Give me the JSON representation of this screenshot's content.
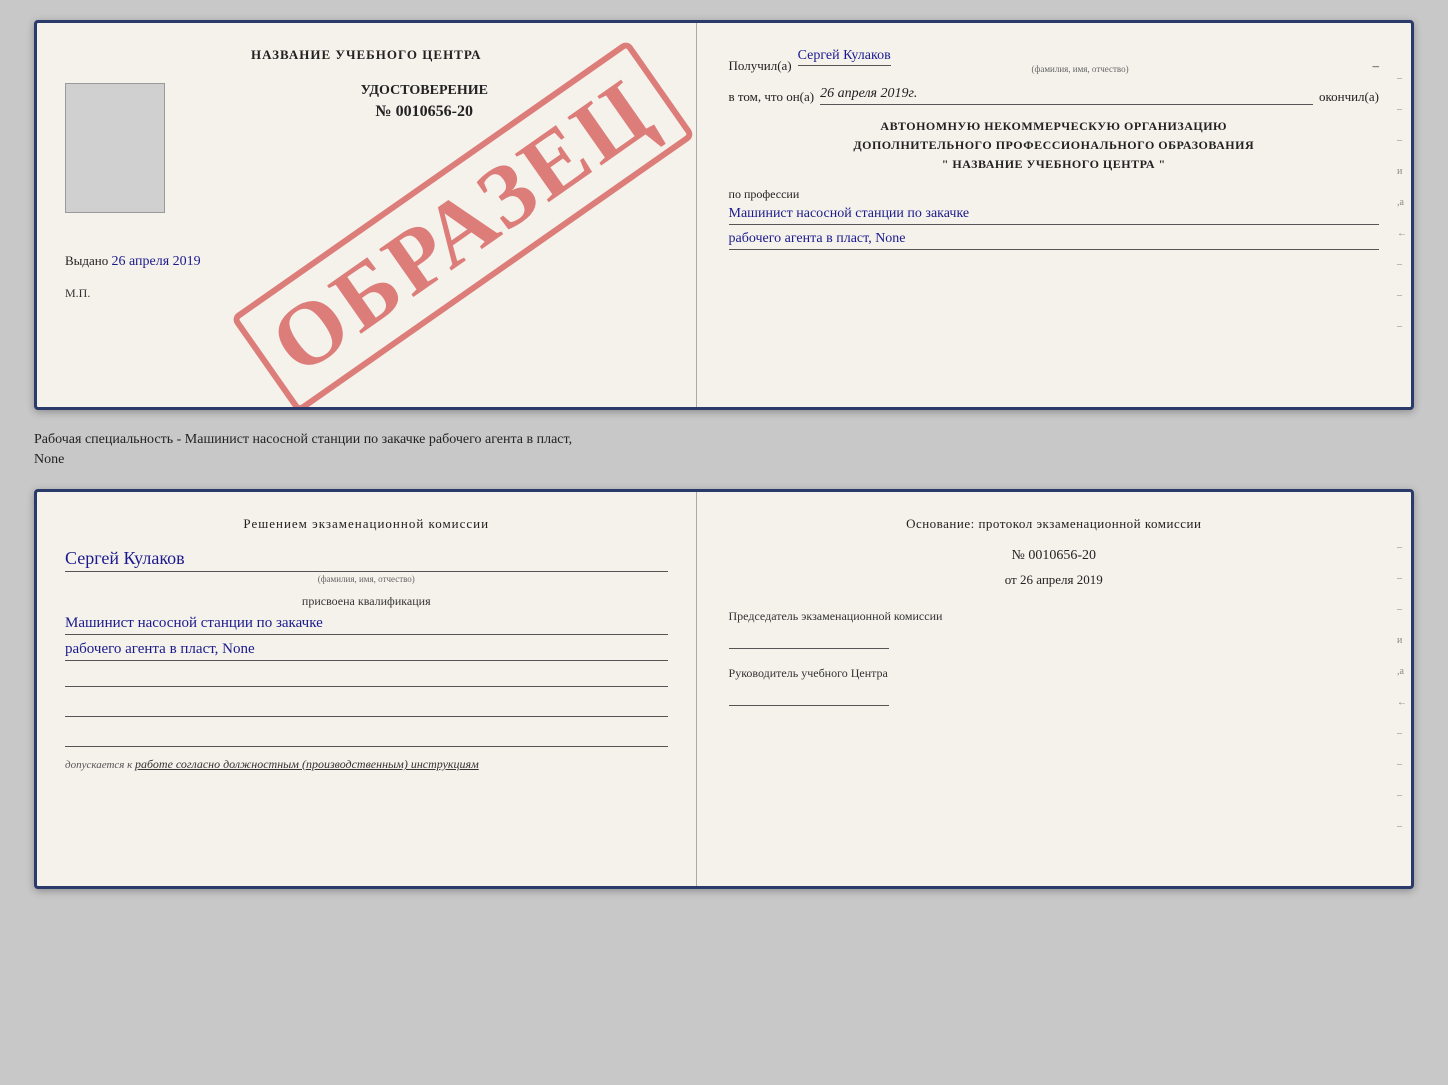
{
  "top_document": {
    "left": {
      "title": "НАЗВАНИЕ УЧЕБНОГО ЦЕНТРА",
      "udostoverenie_label": "УДОСТОВЕРЕНИЕ",
      "number": "№ 0010656-20",
      "obrazec": "ОБРАЗЕЦ",
      "issued_label": "Выдано",
      "issued_date": "26 апреля 2019",
      "mp_label": "М.П."
    },
    "right": {
      "poluchil_label": "Получил(а)",
      "person_name": "Сергей Кулаков",
      "name_hint": "(фамилия, имя, отчество)",
      "vtom_label": "в том, что он(а)",
      "date_value": "26 апреля 2019г.",
      "okonchil_label": "окончил(а)",
      "org_line1": "АВТОНОМНУЮ НЕКОММЕРЧЕСКУЮ ОРГАНИЗАЦИЮ",
      "org_line2": "ДОПОЛНИТЕЛЬНОГО ПРОФЕССИОНАЛЬНОГО ОБРАЗОВАНИЯ",
      "org_line3": "\" НАЗВАНИЕ УЧЕБНОГО ЦЕНТРА \"",
      "po_professii": "по профессии",
      "profession_line1": "Машинист насосной станции по закачке",
      "profession_line2": "рабочего агента в пласт, None",
      "side_marks": [
        "-",
        "-",
        "-",
        "и",
        ",а",
        "←",
        "-",
        "-",
        "-"
      ]
    }
  },
  "between_text": {
    "line1": "Рабочая специальность - Машинист насосной станции по закачке рабочего агента в пласт,",
    "line2": "None"
  },
  "bottom_document": {
    "left": {
      "commission_title": "Решением  экзаменационной  комиссии",
      "person_name": "Сергей Кулаков",
      "name_hint": "(фамилия, имя, отчество)",
      "prisvoena_label": "присвоена квалификация",
      "qualification_line1": "Машинист насосной станции по закачке",
      "qualification_line2": "рабочего агента в пласт, None",
      "dopusk_label": "допускается к",
      "dopusk_value": "работе согласно должностным (производственным) инструкциям"
    },
    "right": {
      "osnov_title": "Основание:  протокол  экзаменационной  комиссии",
      "protocol_number": "№  0010656-20",
      "protocol_date_prefix": "от",
      "protocol_date": "26 апреля 2019",
      "chairman_label": "Председатель экзаменационной комиссии",
      "руководитель_label": "Руководитель учебного Центра",
      "side_marks": [
        "-",
        "-",
        "-",
        "и",
        ",а",
        "←",
        "-",
        "-",
        "-",
        "-"
      ]
    }
  }
}
